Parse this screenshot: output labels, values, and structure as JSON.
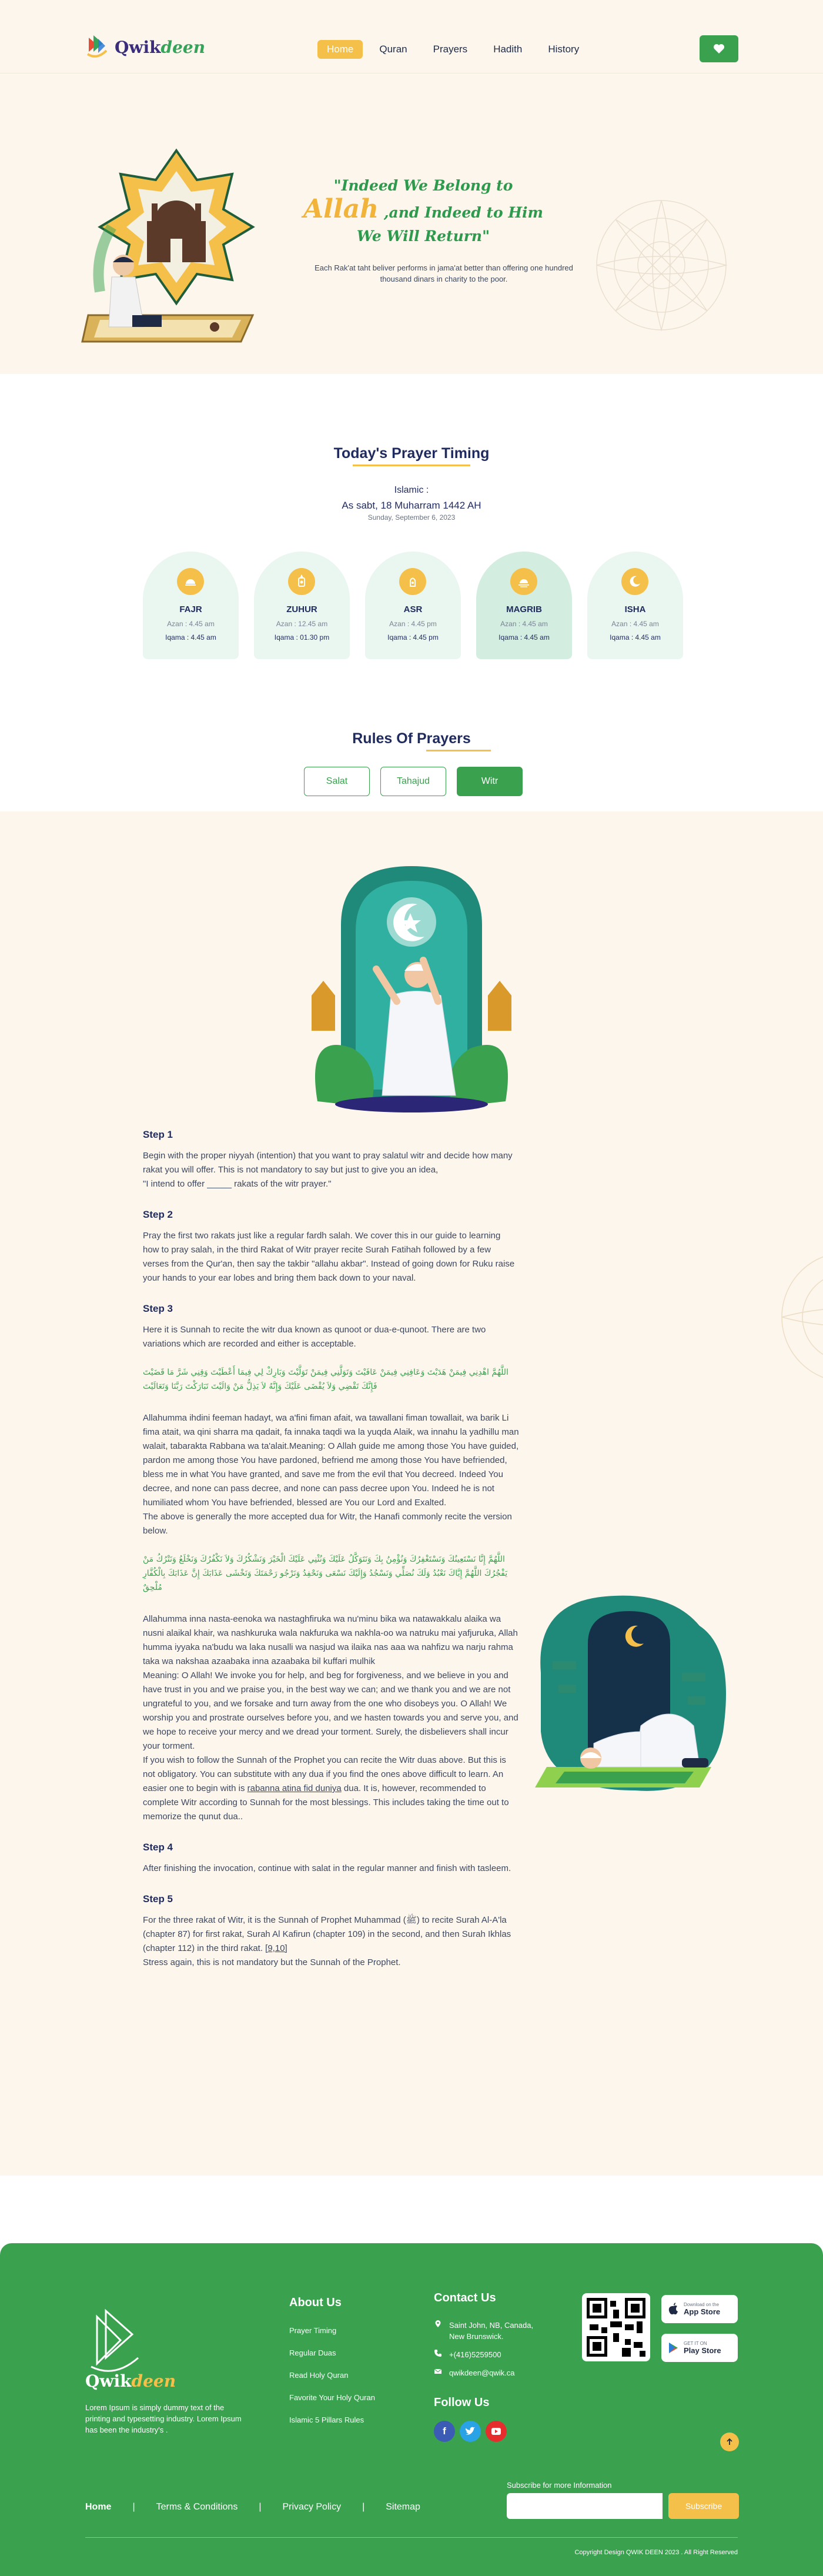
{
  "header": {
    "logo": {
      "q": "Qwik",
      "d": "deen"
    },
    "nav": [
      {
        "label": "Home",
        "active": true
      },
      {
        "label": "Quran",
        "active": false
      },
      {
        "label": "Prayers",
        "active": false
      },
      {
        "label": "Hadith",
        "active": false
      },
      {
        "label": "History",
        "active": false
      }
    ],
    "favorite_icon": "heart-icon"
  },
  "hero": {
    "quote_part1": "\"Indeed We Belong to ",
    "quote_allah": "Allah",
    "quote_part2": " ,and Indeed to Him We Will Return\"",
    "subtitle": "Each Rak'at taht beliver performs in jama'at better than offering one hundred thousand dinars in charity to the poor."
  },
  "timing": {
    "title": "Today's Prayer Timing",
    "islamic_label": "Islamic :",
    "islamic_date": "As sabt, 18 Muharram 1442 AH",
    "gregorian_date": "Sunday, September 6, 2023",
    "prayers": [
      {
        "name": "FAJR",
        "azan": "Azan : 4.45 am",
        "iqama": "Iqama : 4.45 am",
        "icon": "sunrise-icon",
        "active": false
      },
      {
        "name": "ZUHUR",
        "azan": "Azan : 12.45 am",
        "iqama": "Iqama : 01.30 pm",
        "icon": "lantern-icon",
        "active": false
      },
      {
        "name": "ASR",
        "azan": "Azan : 4.45 pm",
        "iqama": "Iqama : 4.45 pm",
        "icon": "lamp-icon",
        "active": false
      },
      {
        "name": "MAGRIB",
        "azan": "Azan : 4.45 am",
        "iqama": "Iqama : 4.45 am",
        "icon": "sunset-icon",
        "active": true
      },
      {
        "name": "ISHA",
        "azan": "Azan : 4.45 am",
        "iqama": "Iqama : 4.45 am",
        "icon": "moon-icon",
        "active": false
      }
    ]
  },
  "rules": {
    "title": "Rules Of Prayers",
    "tabs": [
      {
        "label": "Salat",
        "active": false
      },
      {
        "label": "Tahajud",
        "active": false
      },
      {
        "label": "Witr",
        "active": true
      }
    ],
    "step1_h": "Step 1",
    "step1_p": "Begin with the proper niyyah (intention) that you want to pray salatul witr and decide how many rakat you will offer. This is not mandatory to say but just to give you an idea,\n\"I intend to offer _____ rakats of the witr prayer.\"",
    "step2_h": "Step 2",
    "step2_p": "Pray the first two rakats just like a regular fardh salah. We cover this in our guide to learning how to  pray salah, in the third Rakat of Witr prayer recite Surah Fatihah followed by a few verses from the Qur'an, then say the takbir \"allahu akbar\". Instead of going down for Ruku raise your hands to your ear lobes and bring them back down to your naval.",
    "step3_h": "Step 3",
    "step3_p1": "Here it is Sunnah to recite the witr dua known as qunoot or dua-e-qunoot. There are two variations which are recorded and either is acceptable.",
    "arabic1": "اللَّهُمَّ اهْدِنِي فِيمَنْ هَدَيْتَ وَعَافِنِي فِيمَنْ عَافَيْتَ وَتَوَلَّنِي فِيمَنْ تَوَلَّيْتَ وَبَارِكْ لِي فِيمَا أَعْطَيْتَ وَقِنِي شَرَّ مَا قَضَيْتَ فَإِنَّكَ تَقْضِي وَلاَ يُقْضَى عَلَيْكَ وَإِنَّهُ لاَ يَذِلُّ مَنْ وَالَيْتَ تَبَارَكْتَ رَبَّنَا وَتَعَالَيْتَ",
    "step3_p2": "Allahumma ihdini feeman hadayt, wa a'fini fiman afait, wa tawallani fiman towallait, wa barik Li fima atait, wa qini sharra ma qadait, fa innaka taqdi wa la yuqda Alaik, wa innahu la yadhillu man walait, tabarakta Rabbana wa ta'alait.Meaning: O Allah guide me among those You have guided, pardon me among those You have pardoned, befriend me among those You have befriended, bless me in what You have granted, and save me from the evil that You decreed. Indeed You decree, and none can pass decree, and none can pass decree upon You. Indeed he is not humiliated whom You have befriended, blessed are You our Lord and Exalted.\nThe above is generally the more accepted dua for Witr, the Hanafi commonly recite the version below.",
    "arabic2": "اللَّهُمَّ إِنَّا نَسْتَعِينُكَ وَنَسْتَغْفِرُكَ وَنُؤْمِنُ بِكَ وَنَتَوَكَّلُ عَلَيْكَ وَنُثْنِي عَلَيْكَ الْخَيْرَ وَنَشْكُرُكَ وَلاَ نَكْفُرُكَ وَنَخْلَعُ وَنَتْرُكُ مَنْ يَفْجُرُكَ اللَّهُمَّ إِيَّاكَ نَعْبُدُ وَلَكَ نُصَلِّي وَنَسْجُدُ وَإِلَيْكَ نَسْعَى وَنَحْفِدُ وَنَرْجُو رَحْمَتَكَ وَنَخْشَى عَذَابَكَ إِنَّ عَذَابَكَ بِالْكُفَّارِ مُلْحِقٌ",
    "step3_p3": "Allahumma inna nasta-eenoka wa nastaghfiruka wa nu'minu bika wa natawakkalu alaika wa nusni alaikal khair, wa nashkuruka wala nakfuruka wa nakhla-oo wa natruku mai yafjuruka, Allah humma iyyaka na'budu wa laka nusalli wa nasjud wa ilaika nas aaa wa nahfizu wa narju rahma taka wa nakshaa azaabaka inna azaabaka bil kuffari mulhik\nMeaning: O Allah! We invoke you for help, and beg for forgiveness, and we believe in you and have trust in you and we praise you, in the best way we can; and we thank you and we are not ungrateful to you, and we forsake and turn away from the one who disobeys you. O Allah! We worship you and prostrate ourselves before you, and we hasten towards you and serve you, and we hope to receive your mercy and we dread your torment. Surely, the disbelievers shall incur your torment.",
    "step3_p4_a": "If you wish to follow the Sunnah of the Prophet you can recite the Witr duas above. But this is not obligatory. You can substitute with any dua if you find the ones above difficult to learn. An easier one to begin with is ",
    "step3_p4_link": "rabanna atina fid duniya",
    "step3_p4_b": " dua. It is, however, recommended to complete Witr according to Sunnah for the most blessings. This includes taking the time out to memorize the qunut dua..",
    "step4_h": "Step 4",
    "step4_p": "After finishing the invocation, continue with salat in the regular manner and finish with tasleem.",
    "step5_h": "Step 5",
    "step5_p_a": "For the three rakat of Witr, it is the Sunnah of Prophet Muhammad (ﷺ) to recite Surah Al-A'la (chapter 87) for first rakat, Surah Al Kafirun (chapter 109) in the second, and then Surah Ikhlas (chapter 112) in the third rakat. ",
    "step5_p_link": "[9,10]",
    "step5_p_b": "\nStress again, this is not mandatory but the Sunnah of the Prophet."
  },
  "footer": {
    "logo": {
      "q": "Qwik",
      "d": "deen"
    },
    "description": "Lorem Ipsum is simply dummy text of the printing and typesetting industry.  Lorem Ipsum has been the industry's .",
    "about_title": "About Us",
    "about_links": [
      "Prayer Timing",
      "Regular Duas",
      "Read Holy Quran",
      "Favorite Your Holy Quran",
      "Islamic 5 Pillars Rules"
    ],
    "contact_title": "Contact Us",
    "address": "Saint John, NB, Canada, New Brunswick.",
    "phone": "+(416)5259500",
    "email": "qwikdeen@qwik.ca",
    "follow_title": "Follow Us",
    "app_store_small": "Download on the",
    "app_store": "App Store",
    "play_store_small": "GET IT ON",
    "play_store": "Play Store",
    "subscribe_label": "Subscribe for more Information",
    "subscribe_placeholder": "",
    "subscribe_button": "Subscribe",
    "bottom_links": [
      "Home",
      "Terms & Conditions",
      "Privacy Policy",
      "Sitemap"
    ],
    "copyright": "Copyright Design QWIK DEEN 2023 . All Right Reserved"
  },
  "colors": {
    "green": "#3aa14f",
    "yellow": "#f5c04a",
    "navy": "#1f2a5e",
    "cream": "#fdf6ec"
  }
}
